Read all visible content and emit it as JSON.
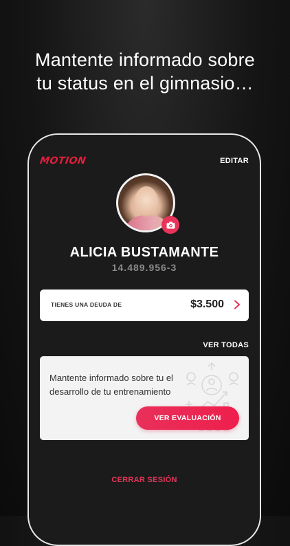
{
  "headline": {
    "line1": "Mantente informado sobre",
    "line2": "tu status en el gimnasio…"
  },
  "app": {
    "logo_text": "MOTION",
    "edit_label": "EDITAR"
  },
  "profile": {
    "name": "ALICIA BUSTAMANTE",
    "rut": "14.489.956-3",
    "camera_icon": "camera-icon"
  },
  "debt": {
    "label": "TIENES UNA DEUDA DE",
    "amount": "$3.500",
    "arrow_icon": "chevron-right-icon"
  },
  "evaluation": {
    "see_all_label": "VER TODAS",
    "description": "Mantente informado sobre tu el desarrollo de tu entrenamiento",
    "button_label": "VER EVALUACIÓN"
  },
  "logout_label": "CERRAR SESIÓN",
  "colors": {
    "accent": "#e8305a",
    "brand_red": "#e31d3c",
    "background": "#151515",
    "card": "#ffffff"
  }
}
